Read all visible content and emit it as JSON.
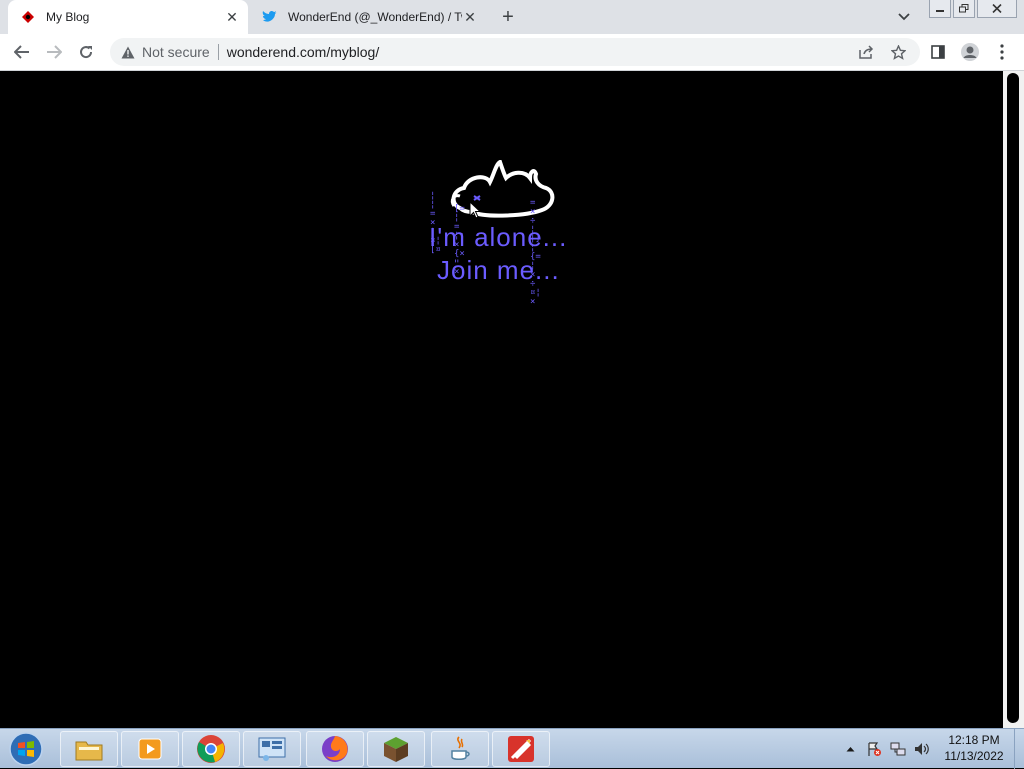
{
  "browser": {
    "tabs": [
      {
        "title": "My Blog",
        "icon": "red-blog-icon",
        "active": true
      },
      {
        "title": "WonderEnd (@_WonderEnd) / Tw",
        "icon": "twitter-icon",
        "active": false
      }
    ],
    "address": {
      "security_label": "Not secure",
      "url": "wonderend.com/myblog/"
    }
  },
  "page": {
    "line1": "I'm alone...",
    "line2": "Join me...",
    "glitch_left": "¦¦=×¦¤¦[¤",
    "glitch_mid": "[=¦=¦;×{×ײ×",
    "glitch_right": "=×÷¦¦}¦{=¦×÷¤¦×",
    "text_color": "#6b5cff",
    "background": "#000000"
  },
  "taskbar": {
    "apps": [
      "file-explorer-icon",
      "media-player-icon",
      "chrome-icon",
      "control-panel-icon",
      "firefox-icon",
      "minecraft-icon",
      "java-icon",
      "rocket-app-icon"
    ],
    "clock_time": "12:18 PM",
    "clock_date": "11/13/2022"
  }
}
